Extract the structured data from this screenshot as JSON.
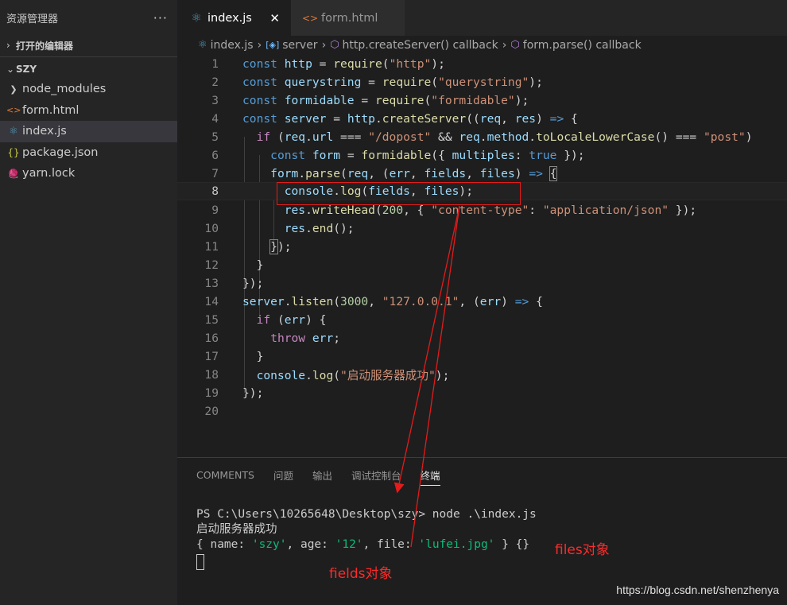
{
  "sidebar": {
    "title": "资源管理器",
    "more_label": "···",
    "open_editors_label": "打开的编辑器",
    "workspace_label": "SZY",
    "items": [
      {
        "label": "node_modules",
        "icon": "chevron-right-icon",
        "glyph": "❯"
      },
      {
        "label": "form.html",
        "icon": "html-file-icon",
        "glyph": "<>"
      },
      {
        "label": "index.js",
        "icon": "react-file-icon",
        "glyph": "⚛"
      },
      {
        "label": "package.json",
        "icon": "json-file-icon",
        "glyph": "{}"
      },
      {
        "label": "yarn.lock",
        "icon": "yarn-file-icon",
        "glyph": "🧶"
      }
    ]
  },
  "tabs": [
    {
      "label": "index.js",
      "icon": "react-file-icon",
      "glyph": "⚛",
      "close": "✕"
    },
    {
      "label": "form.html",
      "icon": "html-file-icon",
      "glyph": "<>"
    }
  ],
  "breadcrumb": {
    "items": [
      "index.js",
      "server",
      "http.createServer() callback",
      "form.parse() callback"
    ],
    "icons": [
      "react-file-icon",
      "variable-icon",
      "method-cube-icon",
      "method-cube-icon"
    ]
  },
  "editor": {
    "current_line": 8,
    "line_numbers": [
      "1",
      "2",
      "3",
      "4",
      "5",
      "6",
      "7",
      "8",
      "9",
      "10",
      "11",
      "12",
      "13",
      "14",
      "15",
      "16",
      "17",
      "18",
      "19",
      "20"
    ]
  },
  "panel": {
    "tabs": [
      "COMMENTS",
      "问题",
      "输出",
      "调试控制台",
      "终端"
    ],
    "active_tab": "终端",
    "terminal": {
      "prompt_line": "PS C:\\Users\\10265648\\Desktop\\szy> node .\\index.js",
      "output_line": "启动服务器成功",
      "obj_open": "{ name: ",
      "name_val": "'szy'",
      "age_key": ", age: ",
      "age_val": "'12'",
      "file_key": ", file: ",
      "file_val": "'lufei.jpg'",
      "obj_close": " } {}"
    }
  },
  "annotations": {
    "files_label": "files对象",
    "fields_label": "fields对象",
    "color": "#ff2a2a"
  },
  "credit": "https://blog.csdn.net/shenzhenya",
  "colors": {
    "background": "#1e1e1e",
    "sidebar": "#252526",
    "keyword": "#569cd6",
    "string": "#ce9178",
    "function": "#dcdcaa",
    "variable": "#9cdcfe"
  }
}
